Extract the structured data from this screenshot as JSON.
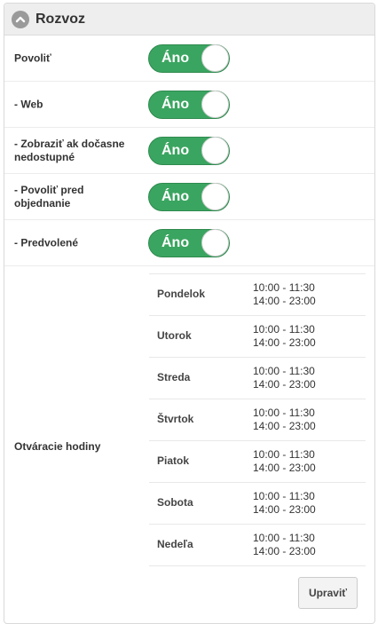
{
  "panel": {
    "title": "Rozvoz"
  },
  "settings": [
    {
      "label": "Povoliť",
      "toggle": "Áno"
    },
    {
      "label": "- Web",
      "toggle": "Áno"
    },
    {
      "label": "- Zobraziť ak dočasne nedostupné",
      "toggle": "Áno"
    },
    {
      "label": "- Povoliť pred objednanie",
      "toggle": "Áno"
    },
    {
      "label": "- Predvolené",
      "toggle": "Áno"
    }
  ],
  "opening_hours": {
    "label": "Otváracie hodiny",
    "days": [
      {
        "day": "Pondelok",
        "slot1": "10:00 - 11:30",
        "slot2": "14:00 - 23:00"
      },
      {
        "day": "Utorok",
        "slot1": "10:00 - 11:30",
        "slot2": "14:00 - 23:00"
      },
      {
        "day": "Streda",
        "slot1": "10:00 - 11:30",
        "slot2": "14:00 - 23:00"
      },
      {
        "day": "Štvrtok",
        "slot1": "10:00 - 11:30",
        "slot2": "14:00 - 23:00"
      },
      {
        "day": "Piatok",
        "slot1": "10:00 - 11:30",
        "slot2": "14:00 - 23:00"
      },
      {
        "day": "Sobota",
        "slot1": "10:00 - 11:30",
        "slot2": "14:00 - 23:00"
      },
      {
        "day": "Nedeľa",
        "slot1": "10:00 - 11:30",
        "slot2": "14:00 - 23:00"
      }
    ]
  },
  "edit_button": {
    "label": "Upraviť"
  },
  "colors": {
    "toggle_on": "#3aa560",
    "header_bg": "#eeeeee"
  },
  "icons": {
    "collapse": "chevron-up-icon"
  }
}
